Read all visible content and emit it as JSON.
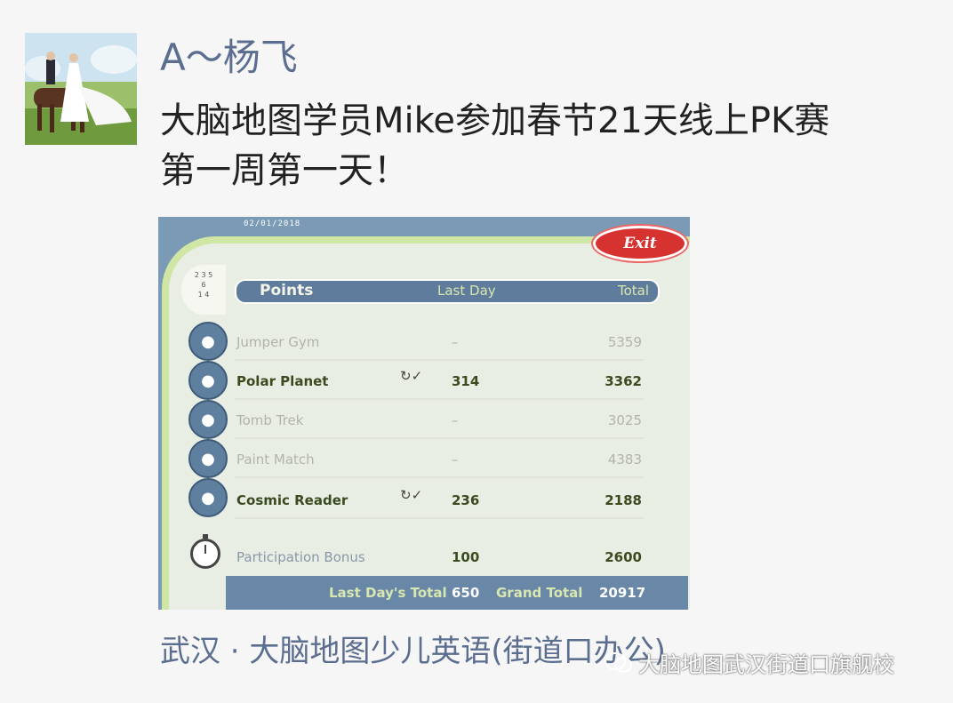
{
  "post": {
    "username": "A～杨飞",
    "text": "大脑地图学员Mike参加春节21天线上PK赛\n第一周第一天！",
    "location": "武汉 · 大脑地图少儿英语(街道口办公)"
  },
  "watermark": {
    "text": "大脑地图武汉街道口旗舰校",
    "icon": "wechat-icon"
  },
  "screenshot": {
    "date": "02/01/2018",
    "exit_label": "Exit",
    "header": {
      "points": "Points",
      "last_day": "Last Day",
      "total": "Total"
    },
    "rows": [
      {
        "name": "Jumper Gym",
        "last_day": "–",
        "total": "5359",
        "highlight": false
      },
      {
        "name": "Polar Planet",
        "last_day": "314",
        "total": "3362",
        "highlight": true
      },
      {
        "name": "Tomb Trek",
        "last_day": "–",
        "total": "3025",
        "highlight": false
      },
      {
        "name": "Paint Match",
        "last_day": "–",
        "total": "4383",
        "highlight": false
      },
      {
        "name": "Cosmic Reader",
        "last_day": "236",
        "total": "2188",
        "highlight": true
      }
    ],
    "bonus": {
      "name": "Participation Bonus",
      "last_day": "100",
      "total": "2600"
    },
    "footer": {
      "last_days_total_label": "Last Day's Total",
      "last_days_total_value": "650",
      "grand_total_label": "Grand Total",
      "grand_total_value": "20917"
    },
    "numbers_icon_text": "2 3 5\n6\n1 4"
  },
  "colors": {
    "username": "#5b6e90",
    "exit": "#d63230",
    "header_bar": "#5f7c9c",
    "footer_bar": "#6987a7",
    "green_frame": "#cfe6a5"
  }
}
